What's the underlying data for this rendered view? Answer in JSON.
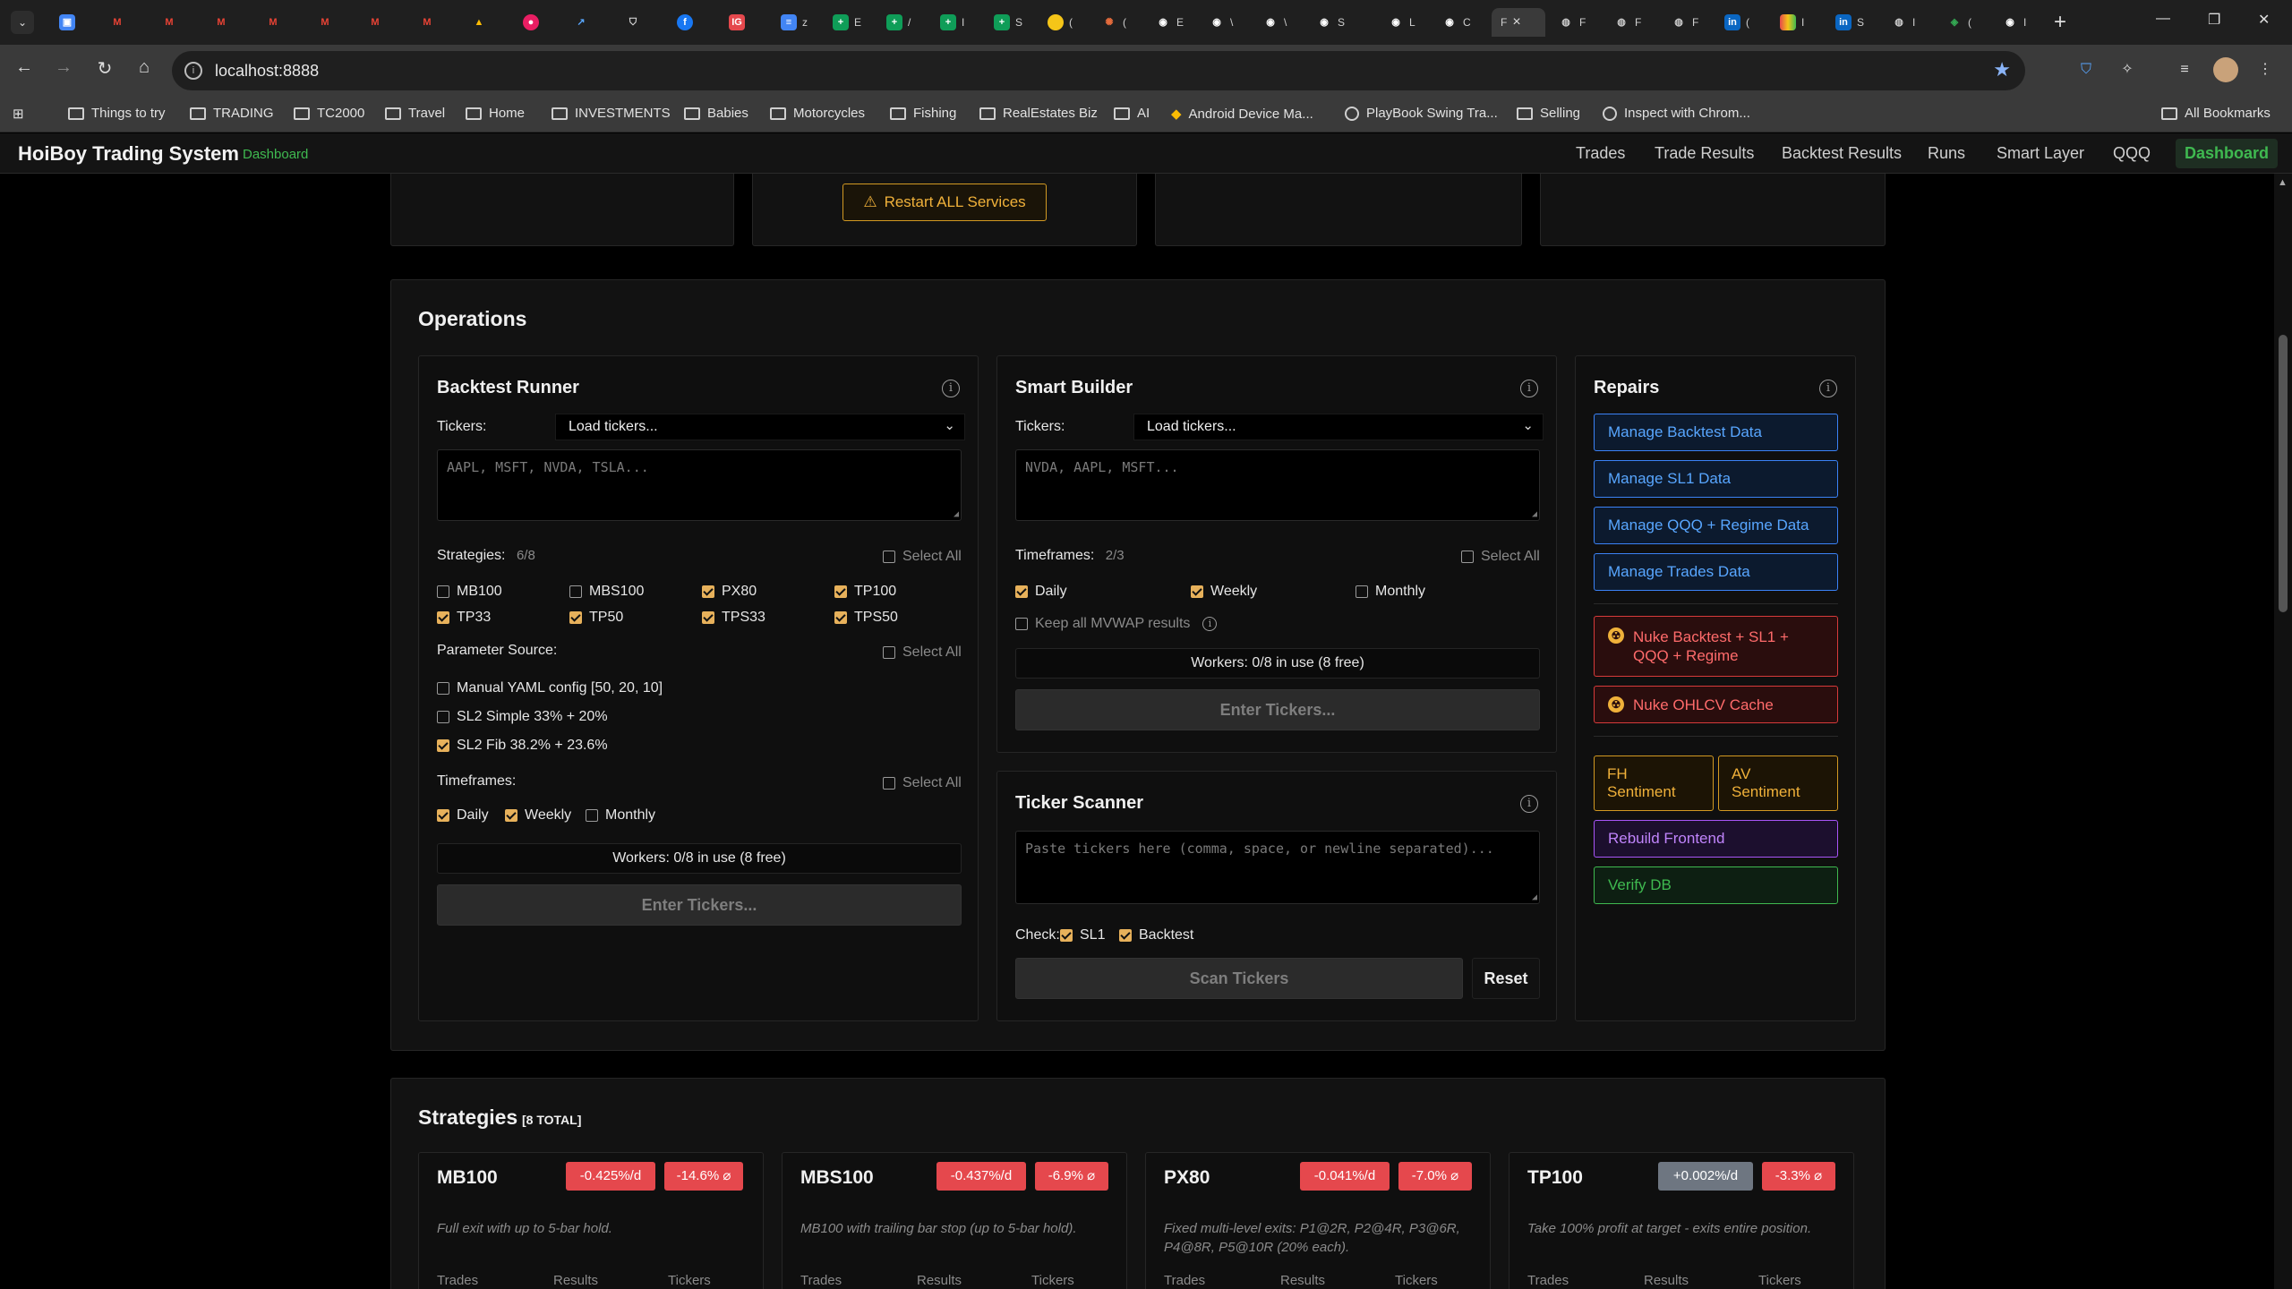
{
  "browser": {
    "tab_titles": [
      "E",
      "\\",
      "E",
      "C",
      "L",
      "F",
      "F",
      "F",
      "I",
      "S"
    ],
    "active_tab_title": "F",
    "url": "localhost:8888",
    "bookmarks": [
      "Things to try",
      "TRADING",
      "TC2000",
      "Travel",
      "Home",
      "INVESTMENTS",
      "Babies",
      "Motorcycles",
      "Fishing",
      "RealEstates Biz",
      "AI",
      "Android Device Ma...",
      "PlayBook Swing Tra...",
      "Selling",
      "Inspect with Chrom..."
    ],
    "all_bookmarks": "All Bookmarks"
  },
  "app": {
    "title": "HoiBoy Trading System",
    "subtitle": "Dashboard",
    "nav": [
      "Trades",
      "Trade Results",
      "Backtest Results",
      "Runs",
      "Smart Layer",
      "QQQ",
      "Dashboard"
    ],
    "active_nav": "Dashboard"
  },
  "services": {
    "restart_label": "Restart ALL Services"
  },
  "operations": {
    "title": "Operations",
    "backtest": {
      "title": "Backtest Runner",
      "tickers_label": "Tickers:",
      "tickers_select": "Load tickers...",
      "textarea_placeholder": "AAPL, MSFT, NVDA, TSLA...",
      "strategies_label": "Strategies:",
      "strategies_count": "6/8",
      "select_all": "Select All",
      "strategies": [
        {
          "label": "MB100",
          "checked": false
        },
        {
          "label": "MBS100",
          "checked": false
        },
        {
          "label": "PX80",
          "checked": true
        },
        {
          "label": "TP100",
          "checked": true
        },
        {
          "label": "TP33",
          "checked": true
        },
        {
          "label": "TP50",
          "checked": true
        },
        {
          "label": "TPS33",
          "checked": true
        },
        {
          "label": "TPS50",
          "checked": true
        }
      ],
      "param_label": "Parameter Source:",
      "params": [
        {
          "label": "Manual YAML config [50, 20, 10]",
          "checked": false
        },
        {
          "label": "SL2 Simple 33% + 20%",
          "checked": false
        },
        {
          "label": "SL2 Fib 38.2% + 23.6%",
          "checked": true
        }
      ],
      "timeframes_label": "Timeframes:",
      "timeframes": [
        {
          "label": "Daily",
          "checked": true
        },
        {
          "label": "Weekly",
          "checked": true
        },
        {
          "label": "Monthly",
          "checked": false
        }
      ],
      "workers": "Workers: 0/8 in use (8 free)",
      "enter_btn": "Enter Tickers..."
    },
    "smart": {
      "title": "Smart Builder",
      "tickers_label": "Tickers:",
      "tickers_select": "Load tickers...",
      "textarea_placeholder": "NVDA, AAPL, MSFT...",
      "timeframes_label": "Timeframes:",
      "timeframes_count": "2/3",
      "select_all": "Select All",
      "timeframes": [
        {
          "label": "Daily",
          "checked": true
        },
        {
          "label": "Weekly",
          "checked": true
        },
        {
          "label": "Monthly",
          "checked": false
        }
      ],
      "keep_mvwap": "Keep all MVWAP results",
      "workers": "Workers: 0/8 in use (8 free)",
      "enter_btn": "Enter Tickers..."
    },
    "scanner": {
      "title": "Ticker Scanner",
      "textarea_placeholder": "Paste tickers here (comma, space, or newline separated)...",
      "check_label": "Check:",
      "checks": [
        {
          "label": "SL1",
          "checked": true
        },
        {
          "label": "Backtest",
          "checked": true
        }
      ],
      "scan_btn": "Scan Tickers",
      "reset_btn": "Reset"
    },
    "repairs": {
      "title": "Repairs",
      "buttons": [
        "Manage Backtest Data",
        "Manage SL1 Data",
        "Manage QQQ + Regime Data",
        "Manage Trades Data"
      ],
      "nuke_buttons": [
        "Nuke Backtest + SL1 + QQQ + Regime",
        "Nuke OHLCV Cache"
      ],
      "sentiment_buttons": [
        "FH Sentiment",
        "AV Sentiment"
      ],
      "rebuild": "Rebuild Frontend",
      "verify": "Verify DB"
    }
  },
  "strategies": {
    "title": "Strategies",
    "total": "[8 TOTAL]",
    "cards": [
      {
        "name": "MB100",
        "rate": "-0.425%/d",
        "avg": "-14.6% ⌀",
        "rate_color": "red",
        "desc": "Full exit with up to 5-bar hold."
      },
      {
        "name": "MBS100",
        "rate": "-0.437%/d",
        "avg": "-6.9% ⌀",
        "rate_color": "red",
        "desc": "MB100 with trailing bar stop (up to 5-bar hold)."
      },
      {
        "name": "PX80",
        "rate": "-0.041%/d",
        "avg": "-7.0% ⌀",
        "rate_color": "red",
        "desc": "Fixed multi-level exits: P1@2R, P2@4R, P3@6R, P4@8R, P5@10R (20% each)."
      },
      {
        "name": "TP100",
        "rate": "+0.002%/d",
        "avg": "-3.3% ⌀",
        "rate_color": "gray",
        "desc": "Take 100% profit at target - exits entire position."
      }
    ],
    "footer_labels": [
      "Trades",
      "Results",
      "Tickers"
    ]
  }
}
